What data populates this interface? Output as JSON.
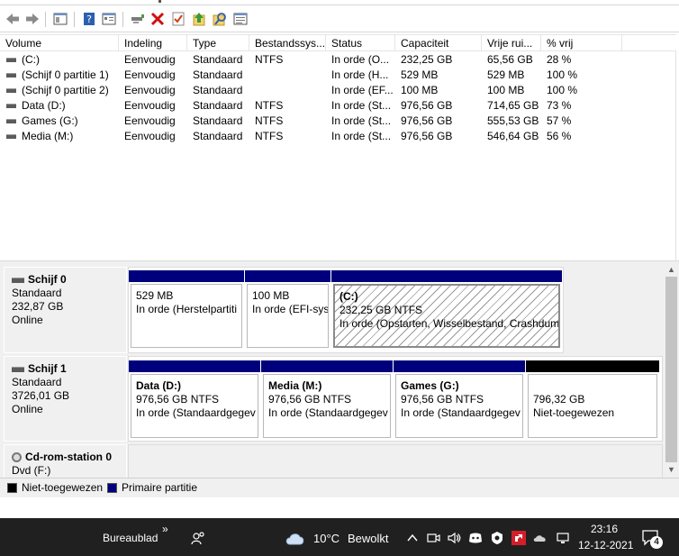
{
  "toolbar": {
    "icons": [
      "back-icon",
      "forward-icon",
      "console-tree-icon",
      "help-icon",
      "properties-icon",
      "connect-icon",
      "delete-icon",
      "check-icon",
      "up-icon",
      "search-icon",
      "details-icon"
    ]
  },
  "volume_list": {
    "columns": [
      "Volume",
      "Indeling",
      "Type",
      "Bestandssys...",
      "Status",
      "Capaciteit",
      "Vrije rui...",
      "% vrij"
    ],
    "rows": [
      {
        "volume": "(C:)",
        "layout": "Eenvoudig",
        "type": "Standaard",
        "fs": "NTFS",
        "status": "In orde (O...",
        "capacity": "232,25 GB",
        "free": "65,56 GB",
        "pct": "28 %"
      },
      {
        "volume": "(Schijf 0 partitie 1)",
        "layout": "Eenvoudig",
        "type": "Standaard",
        "fs": "",
        "status": "In orde (H...",
        "capacity": "529 MB",
        "free": "529 MB",
        "pct": "100 %"
      },
      {
        "volume": "(Schijf 0 partitie 2)",
        "layout": "Eenvoudig",
        "type": "Standaard",
        "fs": "",
        "status": "In orde (EF...",
        "capacity": "100 MB",
        "free": "100 MB",
        "pct": "100 %"
      },
      {
        "volume": "Data (D:)",
        "layout": "Eenvoudig",
        "type": "Standaard",
        "fs": "NTFS",
        "status": "In orde (St...",
        "capacity": "976,56 GB",
        "free": "714,65 GB",
        "pct": "73 %"
      },
      {
        "volume": "Games (G:)",
        "layout": "Eenvoudig",
        "type": "Standaard",
        "fs": "NTFS",
        "status": "In orde (St...",
        "capacity": "976,56 GB",
        "free": "555,53 GB",
        "pct": "57 %"
      },
      {
        "volume": "Media (M:)",
        "layout": "Eenvoudig",
        "type": "Standaard",
        "fs": "NTFS",
        "status": "In orde (St...",
        "capacity": "976,56 GB",
        "free": "546,64 GB",
        "pct": "56 %"
      }
    ]
  },
  "disks": [
    {
      "name": "Schijf 0",
      "type": "Standaard",
      "size": "232,87 GB",
      "status": "Online",
      "partitions": [
        {
          "title": "",
          "size": "529 MB",
          "status": "In orde (Herstelpartiti"
        },
        {
          "title": "",
          "size": "100 MB",
          "status": "In orde (EFI-sys"
        },
        {
          "title": "(C:)",
          "size": "232,25 GB NTFS",
          "status": "In orde (Opstarten, Wisselbestand, Crashdump"
        }
      ]
    },
    {
      "name": "Schijf 1",
      "type": "Standaard",
      "size": "3726,01 GB",
      "status": "Online",
      "partitions": [
        {
          "title": "Data  (D:)",
          "size": "976,56 GB NTFS",
          "status": "In orde (Standaardgegev"
        },
        {
          "title": "Media  (M:)",
          "size": "976,56 GB NTFS",
          "status": "In orde (Standaardgegev"
        },
        {
          "title": "Games  (G:)",
          "size": "976,56 GB NTFS",
          "status": "In orde (Standaardgegev"
        },
        {
          "title": "",
          "size": "796,32 GB",
          "status": "Niet-toegewezen"
        }
      ]
    },
    {
      "name": "Cd-rom-station 0",
      "type": "Dvd (F:)"
    }
  ],
  "legend": {
    "unallocated": "Niet-toegewezen",
    "primary": "Primaire partitie"
  },
  "colors": {
    "primary": "#00007d",
    "unallocated": "#000000",
    "taskbar": "#202020"
  },
  "taskbar": {
    "desktop_label": "Bureaublad",
    "chevron": "»",
    "weather_temp": "10°C",
    "weather_desc": "Bewolkt",
    "time": "23:16",
    "date": "12-12-2021",
    "notification_count": "4"
  }
}
